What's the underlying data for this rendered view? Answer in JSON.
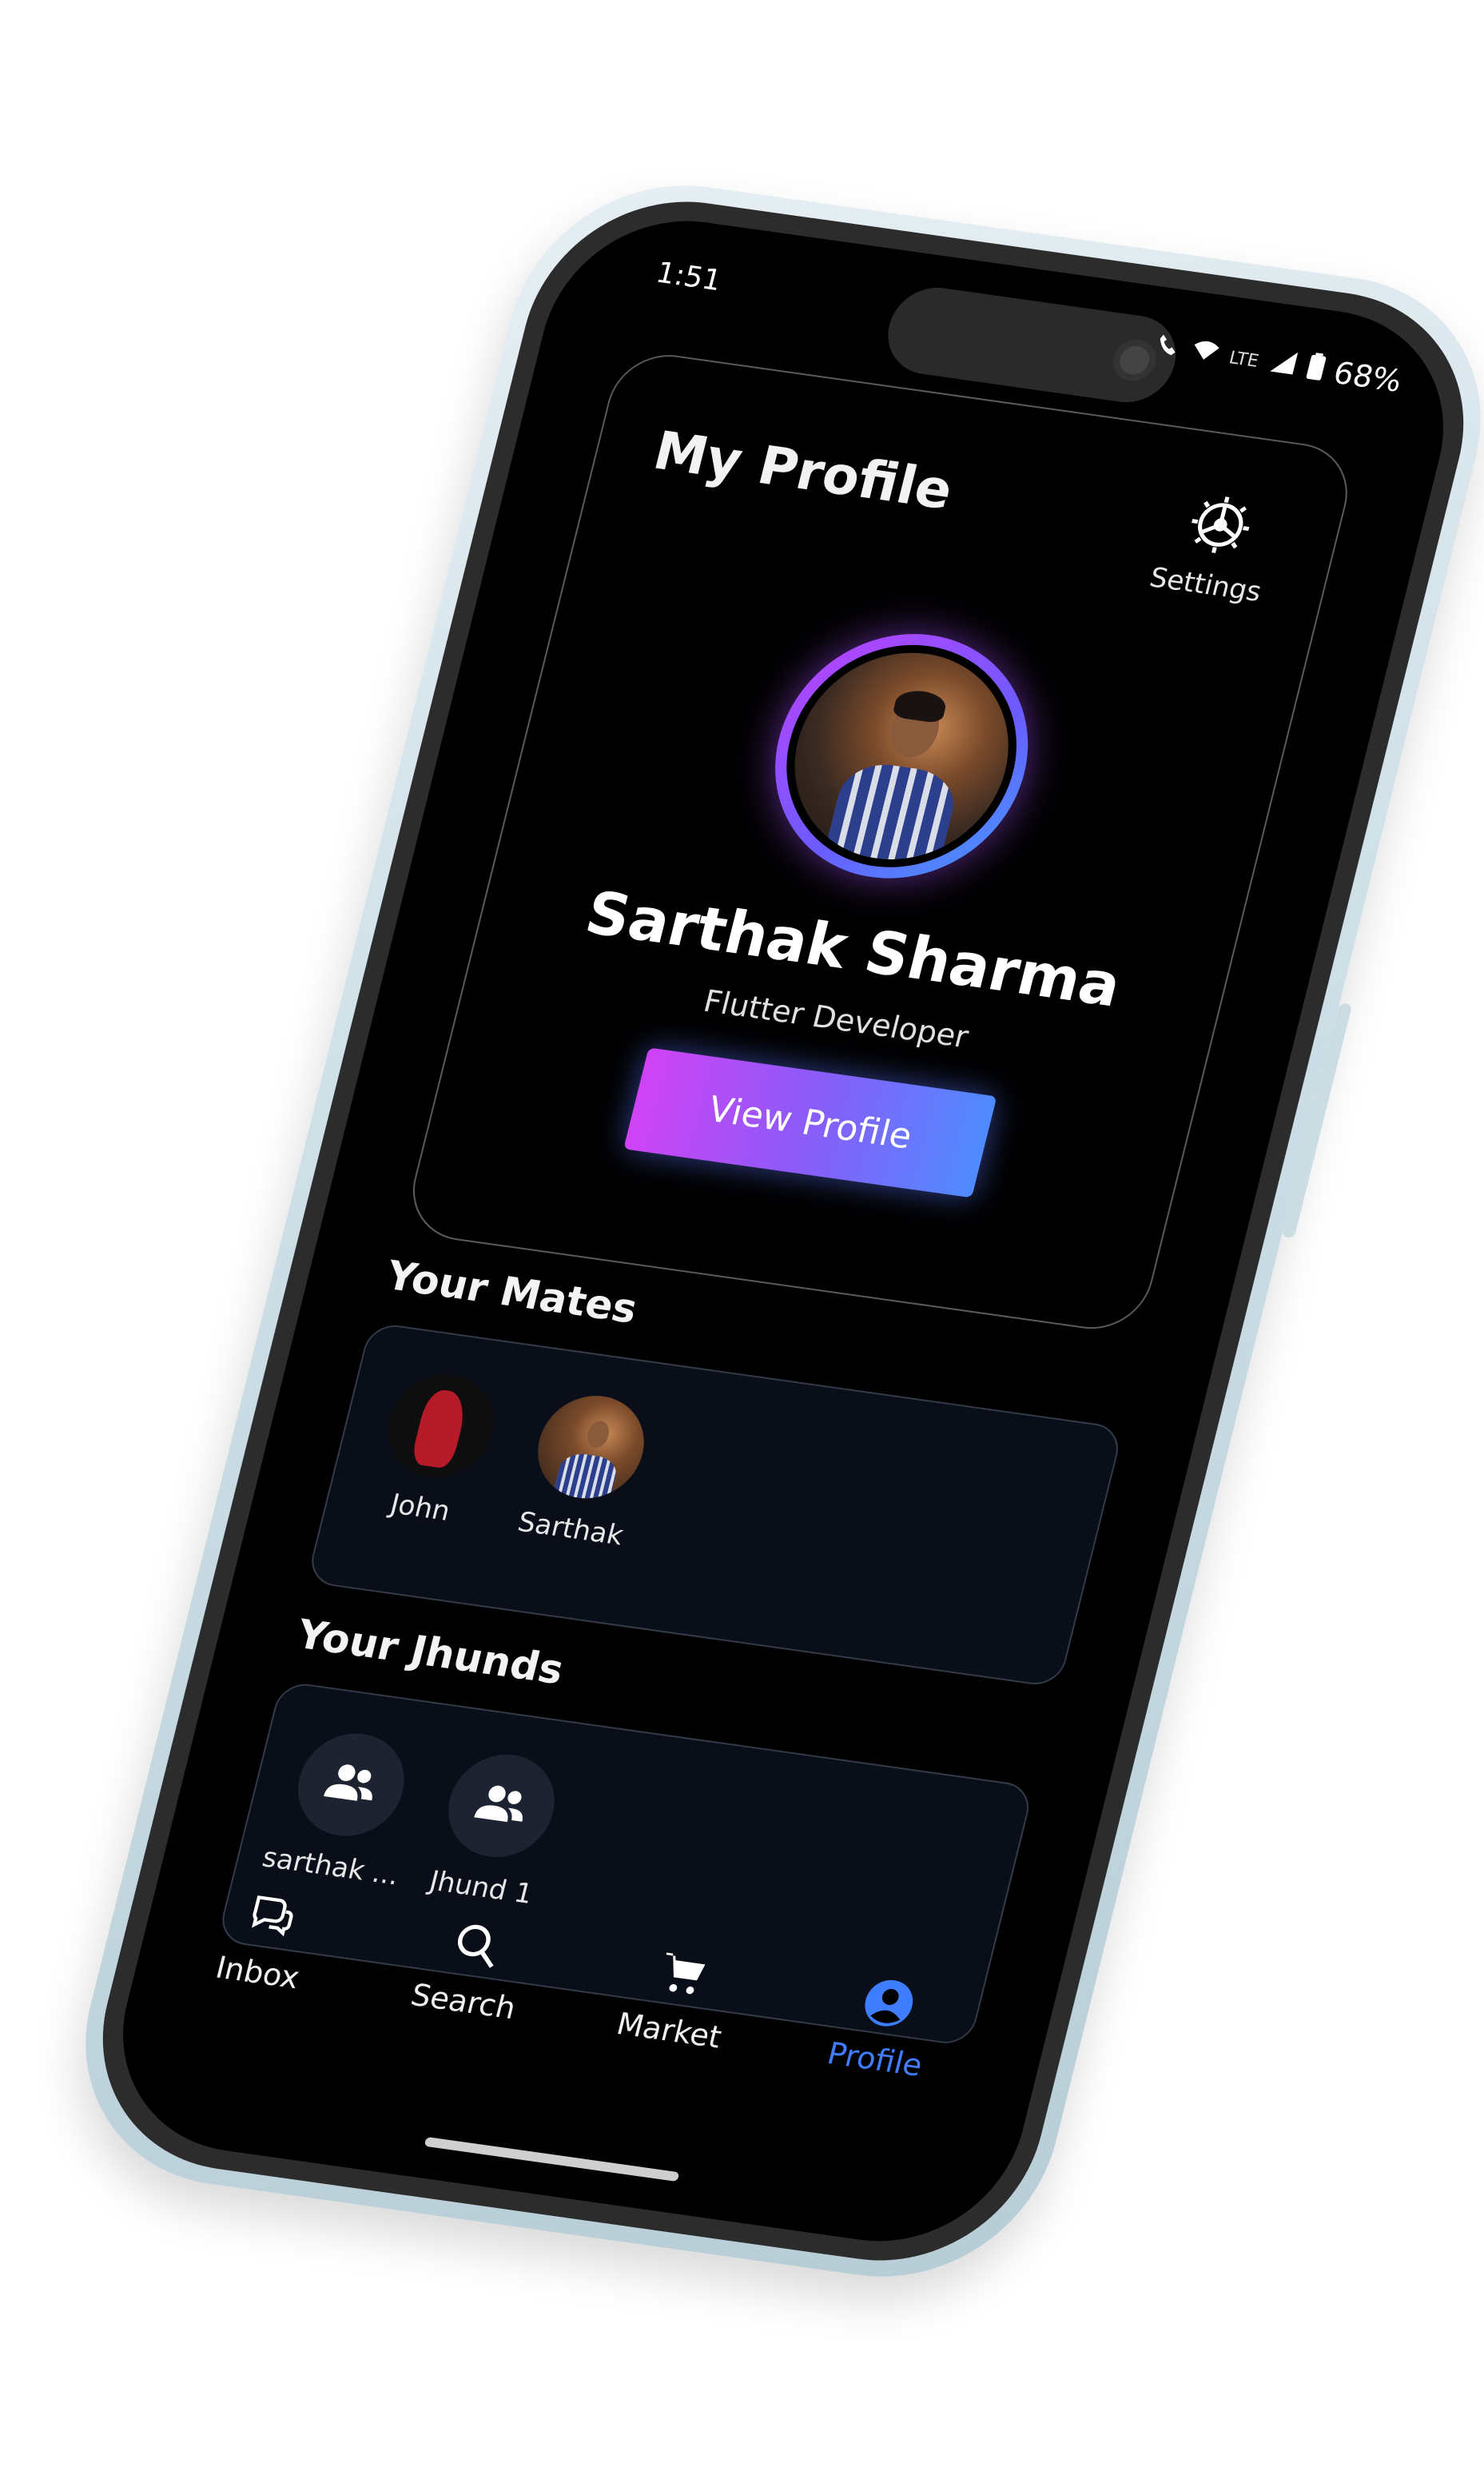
{
  "status_bar": {
    "time": "1:51",
    "network": "LTE",
    "battery": "68%"
  },
  "header": {
    "title": "My Profile",
    "settings_label": "Settings"
  },
  "profile": {
    "name": "Sarthak Sharma",
    "role": "Flutter Developer",
    "view_profile_label": "View Profile"
  },
  "mates": {
    "title": "Your Mates",
    "items": [
      {
        "label": "John"
      },
      {
        "label": "Sarthak"
      }
    ]
  },
  "jhunds": {
    "title": "Your Jhunds",
    "items": [
      {
        "label": "sarthak ..."
      },
      {
        "label": "Jhund 1"
      }
    ]
  },
  "nav": {
    "items": [
      {
        "label": "Inbox",
        "icon": "chat-bubbles-icon"
      },
      {
        "label": "Search",
        "icon": "search-icon"
      },
      {
        "label": "Market",
        "icon": "cart-icon"
      },
      {
        "label": "Profile",
        "icon": "account-circle-icon"
      }
    ],
    "active_color": "#3f7dff"
  },
  "colors": {
    "background": "#000000",
    "panel": "#0a0e19",
    "gradient_start": "#d043f5",
    "gradient_end": "#4f8bff"
  }
}
